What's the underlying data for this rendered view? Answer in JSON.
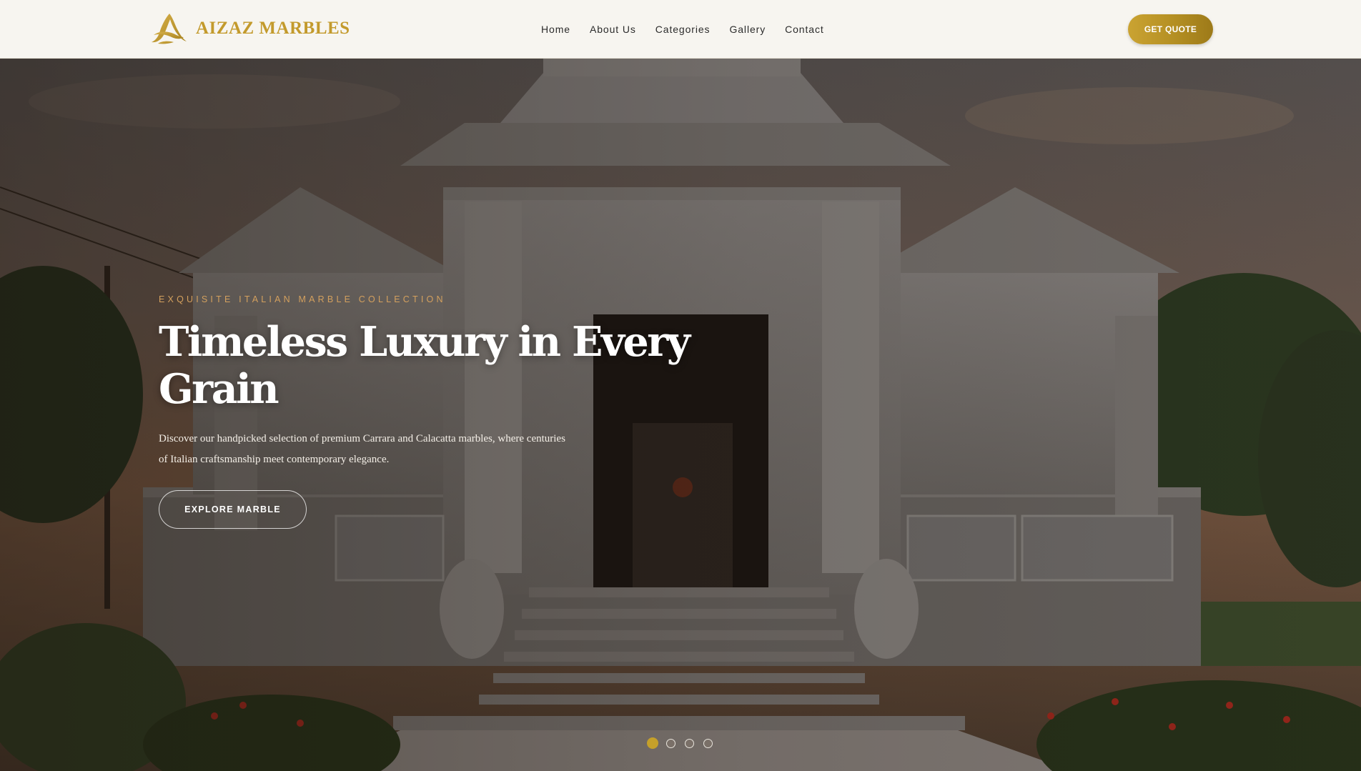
{
  "brand": {
    "name": "AIZAZ MARBLES",
    "color": "#c39a2c",
    "logo_icon": "brand-mark-icon"
  },
  "nav": {
    "items": [
      {
        "label": "Home"
      },
      {
        "label": "About Us"
      },
      {
        "label": "Categories"
      },
      {
        "label": "Gallery"
      },
      {
        "label": "Contact"
      }
    ]
  },
  "header": {
    "cta_label": "GET QUOTE"
  },
  "hero": {
    "eyebrow": "EXQUISITE ITALIAN MARBLE COLLECTION",
    "title": "Timeless Luxury in Every Grain",
    "description": "Discover our handpicked selection of premium Carrara and Calacatta marbles, where centuries of Italian craftsmanship meet contemporary elegance.",
    "cta_label": "EXPLORE MARBLE",
    "slides_total": 4,
    "active_slide": 1,
    "background_scene": "white marble temple at dusk"
  },
  "colors": {
    "accent_gold": "#c5a02a",
    "eyebrow": "#d3a05e",
    "header_bg": "#f7f5f0"
  }
}
